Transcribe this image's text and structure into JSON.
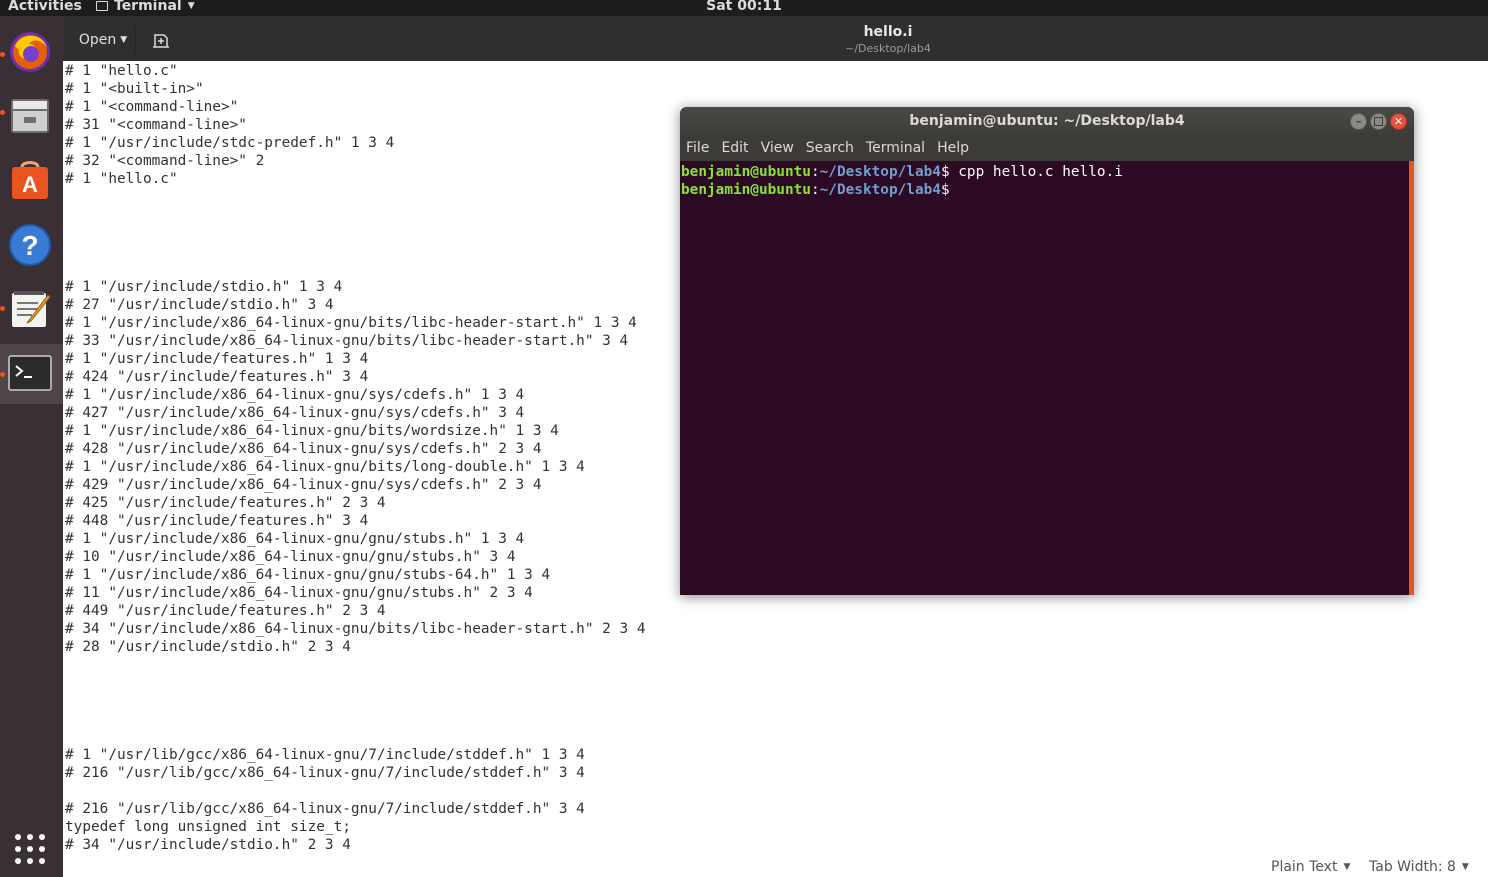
{
  "topbar": {
    "activities": "Activities",
    "app_menu": "Terminal",
    "clock": "Sat 00:11"
  },
  "dock": {
    "apps": [
      "firefox-icon",
      "files-icon",
      "software-center-icon",
      "help-icon",
      "text-editor-icon",
      "terminal-icon",
      "show-applications-icon"
    ]
  },
  "gedit": {
    "open_label": "Open",
    "title": "hello.i",
    "subtitle": "~/Desktop/lab4",
    "lines": [
      "# 1 \"hello.c\"",
      "# 1 \"<built-in>\"",
      "# 1 \"<command-line>\"",
      "# 31 \"<command-line>\"",
      "# 1 \"/usr/include/stdc-predef.h\" 1 3 4",
      "# 32 \"<command-line>\" 2",
      "# 1 \"hello.c\"",
      "",
      "",
      "",
      "",
      "",
      "# 1 \"/usr/include/stdio.h\" 1 3 4",
      "# 27 \"/usr/include/stdio.h\" 3 4",
      "# 1 \"/usr/include/x86_64-linux-gnu/bits/libc-header-start.h\" 1 3 4",
      "# 33 \"/usr/include/x86_64-linux-gnu/bits/libc-header-start.h\" 3 4",
      "# 1 \"/usr/include/features.h\" 1 3 4",
      "# 424 \"/usr/include/features.h\" 3 4",
      "# 1 \"/usr/include/x86_64-linux-gnu/sys/cdefs.h\" 1 3 4",
      "# 427 \"/usr/include/x86_64-linux-gnu/sys/cdefs.h\" 3 4",
      "# 1 \"/usr/include/x86_64-linux-gnu/bits/wordsize.h\" 1 3 4",
      "# 428 \"/usr/include/x86_64-linux-gnu/sys/cdefs.h\" 2 3 4",
      "# 1 \"/usr/include/x86_64-linux-gnu/bits/long-double.h\" 1 3 4",
      "# 429 \"/usr/include/x86_64-linux-gnu/sys/cdefs.h\" 2 3 4",
      "# 425 \"/usr/include/features.h\" 2 3 4",
      "# 448 \"/usr/include/features.h\" 3 4",
      "# 1 \"/usr/include/x86_64-linux-gnu/gnu/stubs.h\" 1 3 4",
      "# 10 \"/usr/include/x86_64-linux-gnu/gnu/stubs.h\" 3 4",
      "# 1 \"/usr/include/x86_64-linux-gnu/gnu/stubs-64.h\" 1 3 4",
      "# 11 \"/usr/include/x86_64-linux-gnu/gnu/stubs.h\" 2 3 4",
      "# 449 \"/usr/include/features.h\" 2 3 4",
      "# 34 \"/usr/include/x86_64-linux-gnu/bits/libc-header-start.h\" 2 3 4",
      "# 28 \"/usr/include/stdio.h\" 2 3 4",
      "",
      "",
      "",
      "",
      "",
      "# 1 \"/usr/lib/gcc/x86_64-linux-gnu/7/include/stddef.h\" 1 3 4",
      "# 216 \"/usr/lib/gcc/x86_64-linux-gnu/7/include/stddef.h\" 3 4",
      "",
      "# 216 \"/usr/lib/gcc/x86_64-linux-gnu/7/include/stddef.h\" 3 4",
      "typedef long unsigned int size_t;",
      "# 34 \"/usr/include/stdio.h\" 2 3 4"
    ],
    "status": {
      "language": "Plain Text",
      "tab_width": "Tab Width: 8"
    }
  },
  "terminal": {
    "title": "benjamin@ubuntu: ~/Desktop/lab4",
    "menu": [
      "File",
      "Edit",
      "View",
      "Search",
      "Terminal",
      "Help"
    ],
    "lines": [
      {
        "user": "benjamin@ubuntu",
        "path": "~/Desktop/lab4",
        "cmd": "$ cpp hello.c hello.i"
      },
      {
        "user": "benjamin@ubuntu",
        "path": "~/Desktop/lab4",
        "cmd": "$"
      }
    ],
    "colors": {
      "background": "#2c0a23",
      "user": "#8ae234",
      "path": "#729fcf",
      "accent": "#e95420"
    }
  }
}
